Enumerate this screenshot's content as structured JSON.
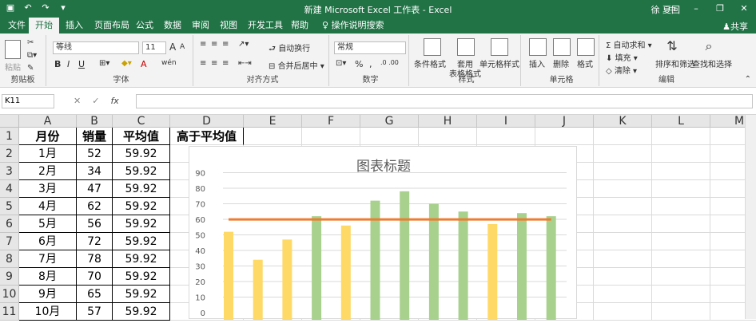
{
  "window": {
    "title": "新建 Microsoft Excel 工作表 - Excel",
    "user": "徐 夏回",
    "share": "共享"
  },
  "menu": {
    "tabs": [
      "文件",
      "开始",
      "插入",
      "页面布局",
      "公式",
      "数据",
      "审阅",
      "视图",
      "开发工具",
      "帮助"
    ],
    "active": "开始",
    "search_hint": "操作说明搜索"
  },
  "ribbon": {
    "clipboard": {
      "paste": "粘贴",
      "label": "剪贴板"
    },
    "font": {
      "name": "等线",
      "size": "11",
      "bold": "B",
      "italic": "I",
      "underline": "U",
      "grow": "A",
      "shrink": "A",
      "color": "A",
      "phonetic": "wén",
      "label": "字体"
    },
    "alignment": {
      "wrap": "自动换行",
      "merge": "合并后居中",
      "label": "对齐方式"
    },
    "number": {
      "format": "常规",
      "percent": "%",
      "comma": ",",
      "label": "数字"
    },
    "styles": {
      "conditional": "条件格式",
      "table_line1": "套用",
      "table_line2": "表格格式",
      "cell_styles": "单元格样式",
      "label": "样式"
    },
    "cells": {
      "insert": "插入",
      "delete": "删除",
      "format": "格式",
      "label": "单元格"
    },
    "editing": {
      "autosum": "自动求和",
      "fill": "填充",
      "clear": "清除",
      "sort": "排序和筛选",
      "find": "查找和选择",
      "label": "编辑"
    }
  },
  "formula_bar": {
    "name_box": "K11",
    "fx": "fx",
    "cancel": "✕",
    "enter": "✓",
    "value": ""
  },
  "columns": [
    "A",
    "B",
    "C",
    "D",
    "E",
    "F",
    "G",
    "H",
    "I",
    "J",
    "K",
    "L",
    "M"
  ],
  "rows": [
    "1",
    "2",
    "3",
    "4",
    "5",
    "6",
    "7",
    "8",
    "9",
    "10",
    "11"
  ],
  "table": {
    "headers": [
      "月份",
      "销量",
      "平均值",
      "高于平均值"
    ],
    "rows": [
      [
        "1月",
        "52",
        "59.92"
      ],
      [
        "2月",
        "34",
        "59.92"
      ],
      [
        "3月",
        "47",
        "59.92"
      ],
      [
        "4月",
        "62",
        "59.92"
      ],
      [
        "5月",
        "56",
        "59.92"
      ],
      [
        "6月",
        "72",
        "59.92"
      ],
      [
        "7月",
        "78",
        "59.92"
      ],
      [
        "8月",
        "70",
        "59.92"
      ],
      [
        "9月",
        "65",
        "59.92"
      ],
      [
        "10月",
        "57",
        "59.92"
      ]
    ]
  },
  "colors": {
    "excel_green": "#217346",
    "bar_yellow": "#ffd966",
    "bar_green": "#a9d18e",
    "avg_line": "#ed7d31"
  },
  "chart_data": {
    "type": "bar",
    "title": "图表标题",
    "ylim": [
      0,
      90
    ],
    "yticks": [
      "0",
      "10",
      "20",
      "30",
      "40",
      "50",
      "60",
      "70",
      "80",
      "90"
    ],
    "grid": true,
    "series": [
      {
        "values": [
          52,
          34,
          47,
          null,
          56,
          null,
          null,
          null,
          null,
          57,
          null,
          null
        ],
        "color": "#ffd966"
      },
      {
        "values": [
          null,
          null,
          null,
          62,
          null,
          72,
          78,
          70,
          65,
          null,
          64,
          62
        ],
        "color": "#a9d18e"
      }
    ],
    "average": 59.92
  }
}
